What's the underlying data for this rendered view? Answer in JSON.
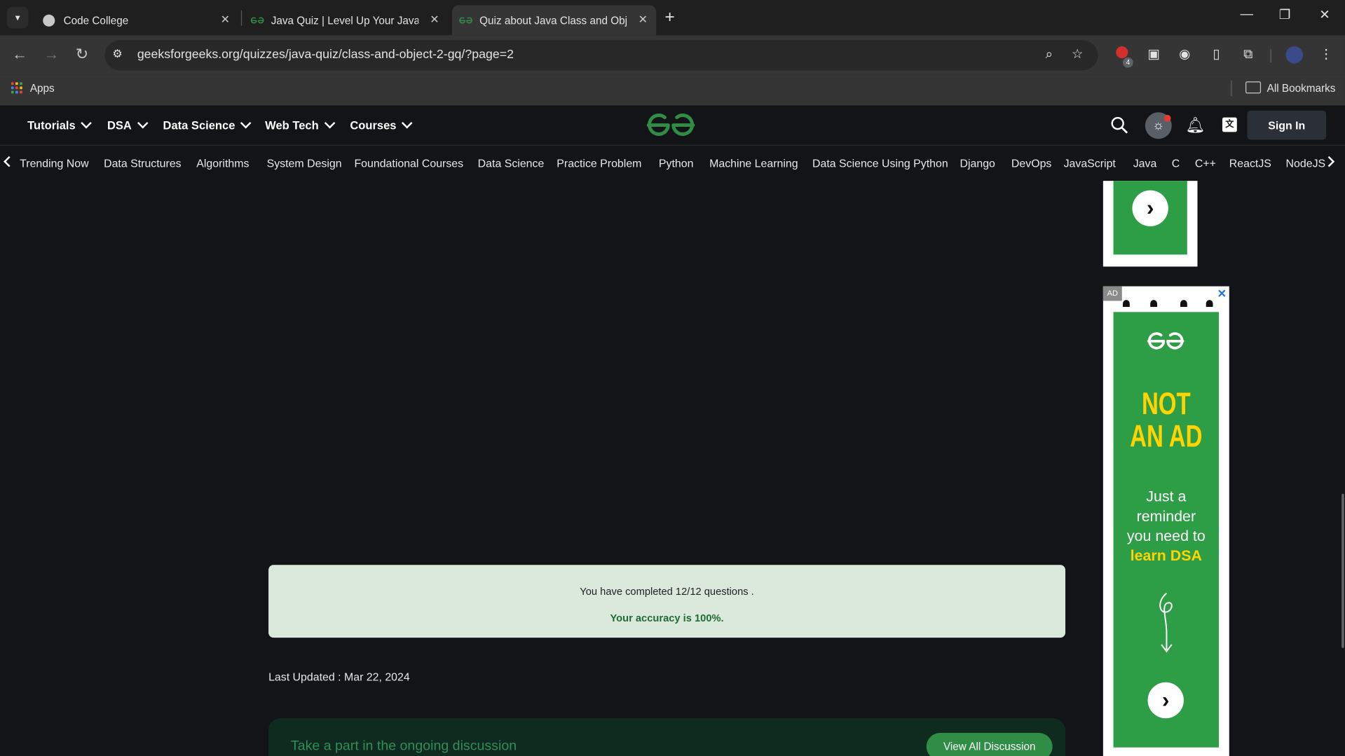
{
  "browser": {
    "tabs": [
      {
        "title": "Code College",
        "active": false
      },
      {
        "title": "Java Quiz | Level Up Your Java Skills",
        "active": false
      },
      {
        "title": "Quiz about Java Class and Object",
        "active": true
      }
    ],
    "url": "geeksforgeeks.org/quizzes/java-quiz/class-and-object-2-gq/?page=2",
    "extension_badge": "4",
    "bookmarks": {
      "apps_label": "Apps",
      "all_bookmarks_label": "All Bookmarks"
    }
  },
  "site": {
    "main_nav": [
      "Tutorials",
      "DSA",
      "Data Science",
      "Web Tech",
      "Courses"
    ],
    "sign_in_label": "Sign In",
    "sub_nav": [
      "Trending Now",
      "Data Structures",
      "Algorithms",
      "System Design",
      "Foundational Courses",
      "Data Science",
      "Practice Problem",
      "Python",
      "Machine Learning",
      "Data Science Using Python",
      "Django",
      "DevOps",
      "JavaScript",
      "Java",
      "C",
      "C++",
      "ReactJS",
      "NodeJS"
    ]
  },
  "result": {
    "completed_text": "You have completed 12/12 questions .",
    "accuracy_text": "Your accuracy is 100%."
  },
  "last_updated": "Last Updated : Mar 22, 2024",
  "discussion": {
    "prompt": "Take a part in the ongoing discussion",
    "button_label": "View All Discussion"
  },
  "ad": {
    "label": "AD",
    "close": "✕",
    "headline_1": "NOT",
    "headline_2": "AN AD",
    "body_1": "Just a",
    "body_2": "reminder",
    "body_3": "you need to",
    "body_4": "learn DSA"
  },
  "colors": {
    "accent": "#2f8d46",
    "background": "#131417",
    "result_bg": "#dbe9dd"
  }
}
